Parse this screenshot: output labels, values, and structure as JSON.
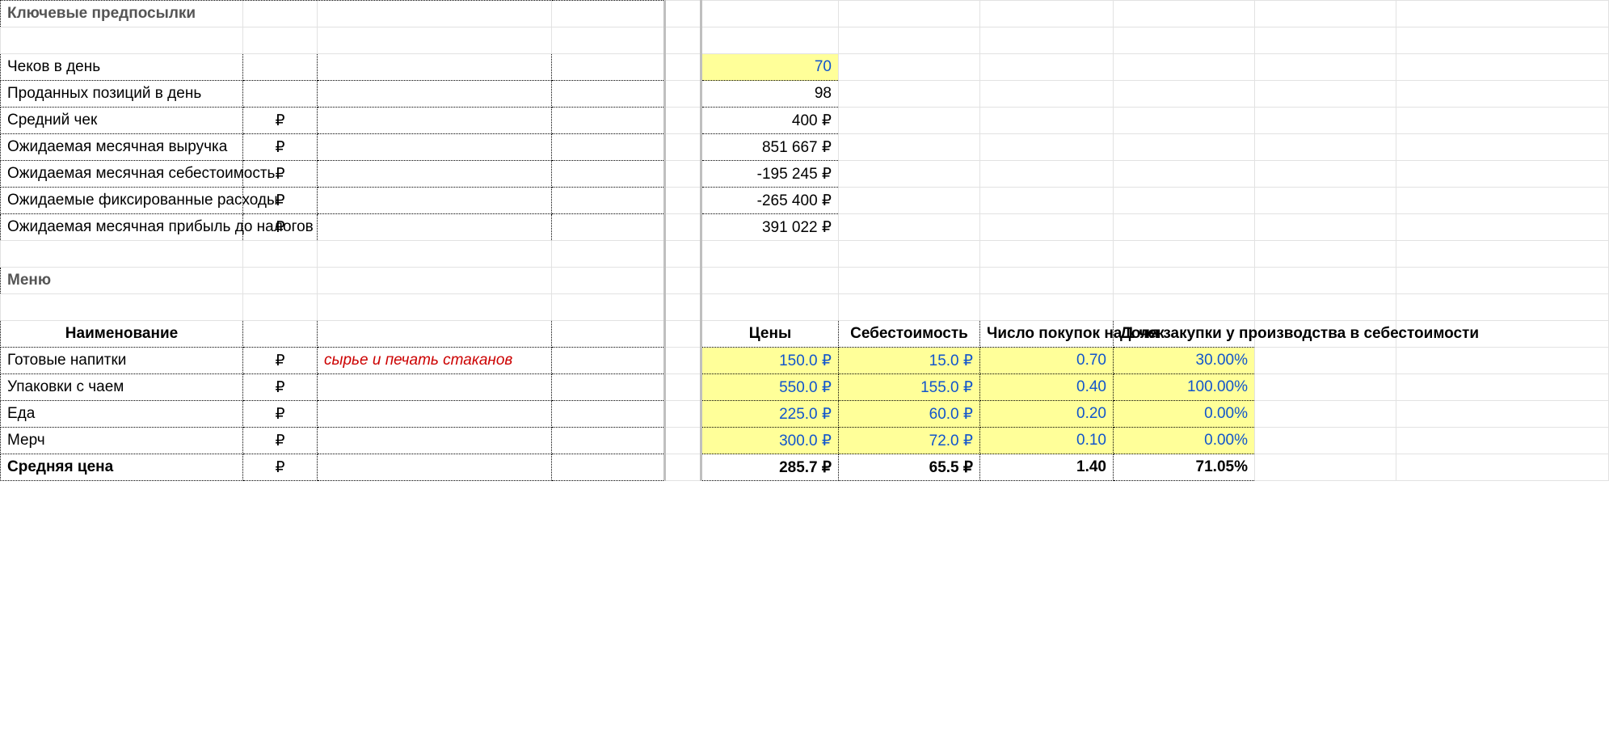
{
  "assumptions": {
    "title": "Ключевые предпосылки",
    "rows": {
      "checks_per_day": {
        "label": "Чеков в день",
        "unit": "",
        "value": "70"
      },
      "items_per_day": {
        "label": "Проданных позиций в день",
        "unit": "",
        "value": "98"
      },
      "avg_check": {
        "label": "Средний чек",
        "unit": "₽",
        "value": "400 ₽"
      },
      "monthly_revenue": {
        "label": "Ожидаемая месячная выручка",
        "unit": "₽",
        "value": "851 667 ₽"
      },
      "monthly_cogs": {
        "label": "Ожидаемая месячная себестоимость",
        "unit": "₽",
        "value": "-195 245 ₽"
      },
      "fixed_costs": {
        "label": "Ожидаемые фиксированные расходы",
        "unit": "₽",
        "value": "-265 400 ₽"
      },
      "profit_before_tax": {
        "label": "Ожидаемая месячная прибыль до налогов",
        "unit": "₽",
        "value": "391 022 ₽"
      }
    }
  },
  "menu": {
    "title": "Меню",
    "headers": {
      "name": "Наименование",
      "price": "Цены",
      "cost": "Себестоимость",
      "per_check": "Число покупок на 1 чек",
      "prod_share": "Доля закупки у производства в себестоимости"
    },
    "items": [
      {
        "name": "Готовые напитки",
        "unit": "₽",
        "note": "сырье и печать стаканов",
        "price": "150.0 ₽",
        "cost": "15.0 ₽",
        "per_check": "0.70",
        "prod_share": "30.00%"
      },
      {
        "name": "Упаковки с чаем",
        "unit": "₽",
        "note": "",
        "price": "550.0 ₽",
        "cost": "155.0 ₽",
        "per_check": "0.40",
        "prod_share": "100.00%"
      },
      {
        "name": "Еда",
        "unit": "₽",
        "note": "",
        "price": "225.0 ₽",
        "cost": "60.0 ₽",
        "per_check": "0.20",
        "prod_share": "0.00%"
      },
      {
        "name": "Мерч",
        "unit": "₽",
        "note": "",
        "price": "300.0 ₽",
        "cost": "72.0 ₽",
        "per_check": "0.10",
        "prod_share": "0.00%"
      }
    ],
    "totals": {
      "label": "Средняя цена",
      "unit": "₽",
      "price": "285.7 ₽",
      "cost": "65.5 ₽",
      "per_check": "1.40",
      "prod_share": "71.05%"
    }
  }
}
